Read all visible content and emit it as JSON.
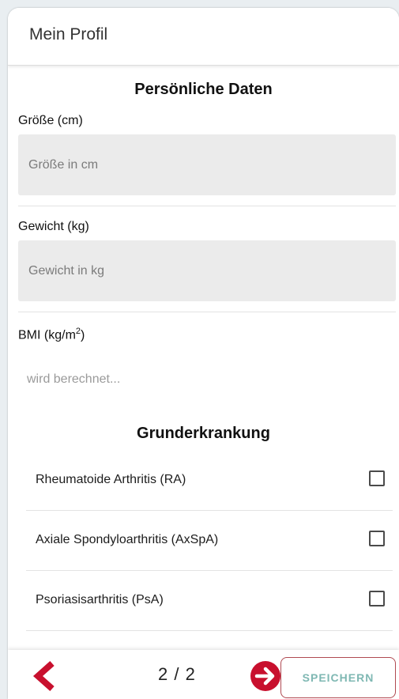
{
  "header": {
    "title": "Mein Profil"
  },
  "personal": {
    "section_title": "Persönliche Daten",
    "height": {
      "label": "Größe (cm)",
      "placeholder": "Größe in cm",
      "value": ""
    },
    "weight": {
      "label": "Gewicht (kg)",
      "placeholder": "Gewicht in kg",
      "value": ""
    },
    "bmi": {
      "label_main": "BMI (kg/m",
      "label_sup": "2",
      "label_end": ")",
      "value": "wird berechnet..."
    }
  },
  "disease": {
    "section_title": "Grunderkrankung",
    "options": [
      {
        "label": "Rheumatoide Arthritis (RA)",
        "checked": false
      },
      {
        "label": "Axiale Spondyloarthritis (AxSpA)",
        "checked": false
      },
      {
        "label": "Psoriasisarthritis (PsA)",
        "checked": false
      }
    ]
  },
  "footer": {
    "back_icon": "chevron-left-icon",
    "pager": "2 / 2",
    "next_icon": "arrow-right-circle-icon",
    "save_label": "SPEICHERN"
  },
  "colors": {
    "accent_red": "#c8102e",
    "save_text": "#7fb8b3",
    "checkbox_peek": "#4f9c97"
  }
}
